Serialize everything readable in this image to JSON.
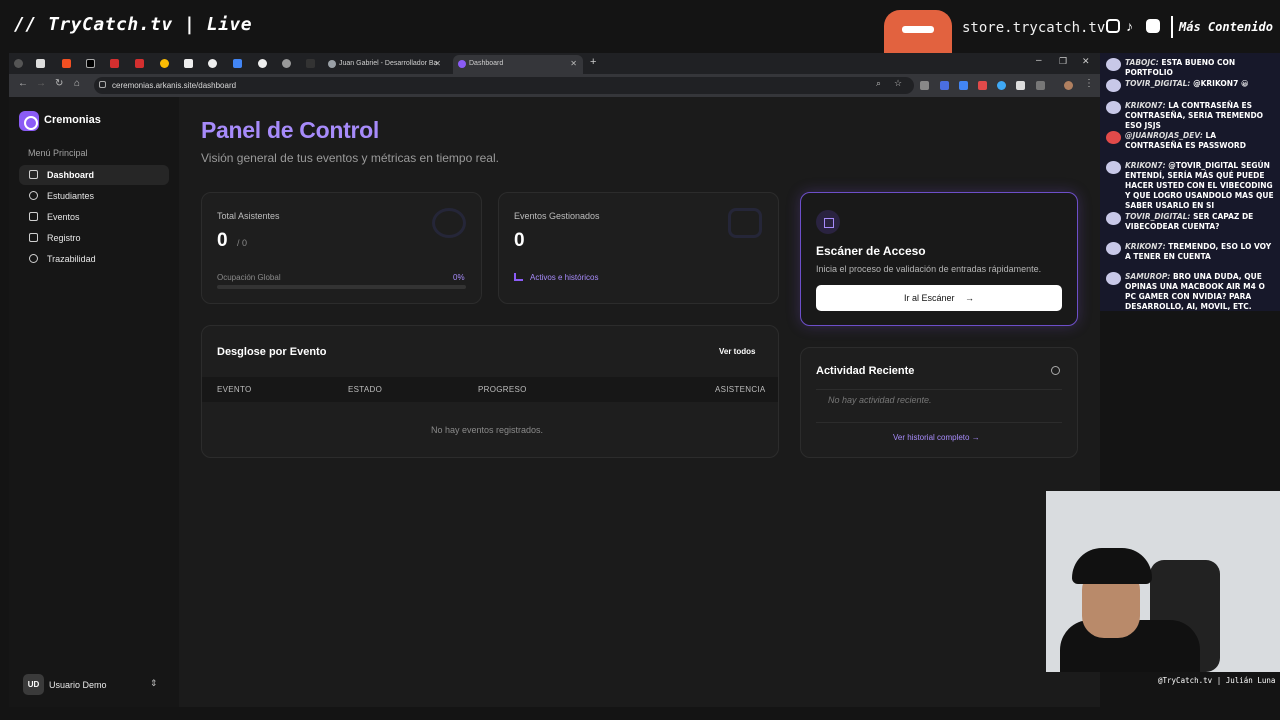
{
  "overlay": {
    "brand": "// TryCatch.tv | Live",
    "store_url": "store.trycatch.tv",
    "more_content": "Más Contenido",
    "cam_tag": "@TryCatch.tv | Julián Luna"
  },
  "browser": {
    "tabs": [
      {
        "title": "Juan Gabriel - Desarrollador Ba"
      },
      {
        "title": "Dashboard"
      }
    ],
    "url": "ceremonias.arkanis.site/dashboard"
  },
  "sidebar": {
    "app_name": "Cremonias",
    "section_label": "Menú Principal",
    "items": [
      {
        "label": "Dashboard"
      },
      {
        "label": "Estudiantes"
      },
      {
        "label": "Eventos"
      },
      {
        "label": "Registro"
      },
      {
        "label": "Trazabilidad"
      }
    ],
    "user": {
      "initials": "UD",
      "name": "Usuario Demo"
    }
  },
  "main": {
    "title": "Panel de Control",
    "subtitle": "Visión general de tus eventos y métricas en tiempo real.",
    "stats": {
      "attendees": {
        "label": "Total Asistentes",
        "value": "0",
        "total": "/ 0",
        "occupancy_label": "Ocupación Global",
        "occupancy_value": "0%",
        "occupancy_fraction": 0
      },
      "events": {
        "label": "Eventos Gestionados",
        "value": "0",
        "link": "Activos e históricos"
      }
    },
    "scanner": {
      "title": "Escáner de Acceso",
      "description": "Inicia el proceso de validación de entradas rápidamente.",
      "button": "Ir al Escáner",
      "button_arrow": "→"
    },
    "breakdown": {
      "title": "Desglose por Evento",
      "view_all": "Ver todos",
      "columns": [
        "EVENTO",
        "ESTADO",
        "PROGRESO",
        "ASISTENCIA"
      ],
      "empty": "No hay eventos registrados."
    },
    "activity": {
      "title": "Actividad Reciente",
      "empty": "No hay actividad reciente.",
      "history_link": "Ver historial completo →"
    }
  },
  "chat": [
    {
      "user": "TABOJC:",
      "text": "ESTA BUENO CON PORTFOLIO"
    },
    {
      "user": "TOVIR_DIGITAL:",
      "text": "@KRIKON7"
    },
    {
      "user": "KRIKON7:",
      "text": "LA CONTRASEÑA ES CONTRASEÑA, SERIA TREMENDO ESO JSJS"
    },
    {
      "user": "@JUANROJAS_DEV:",
      "text": "LA CONTRASEÑA ES PASSWORD"
    },
    {
      "user": "KRIKON7:",
      "text": "@TOVIR_DIGITAL SEGÚN ENTENDÍ, SERÍA MÁS QUÉ PUEDE HACER USTED CON EL VIBECODING Y QUE LOGRO USANDOLO MAS QUE SABER USARLO EN SI"
    },
    {
      "user": "TOVIR_DIGITAL:",
      "text": "SER CAPAZ DE VIBECODEAR CUENTA?"
    },
    {
      "user": "KRIKON7:",
      "text": "TREMENDO, ESO LO VOY A TENER EN CUENTA"
    },
    {
      "user": "SAMUROP:",
      "text": "BRO UNA DUDA, QUE OPINAS UNA MACBOOK AIR M4 O PC GAMER CON NVIDIA? PARA DESARROLLO, AI, MOVIL, ETC."
    }
  ],
  "colors": {
    "accent": "#8b5cf6",
    "accent_text": "#a78bfa",
    "background": "#1b1b1b"
  },
  "icons": [
    "dashboard-icon",
    "students-icon",
    "events-icon",
    "register-icon",
    "traceability-icon",
    "qr-icon",
    "clock-icon",
    "chart-icon"
  ]
}
